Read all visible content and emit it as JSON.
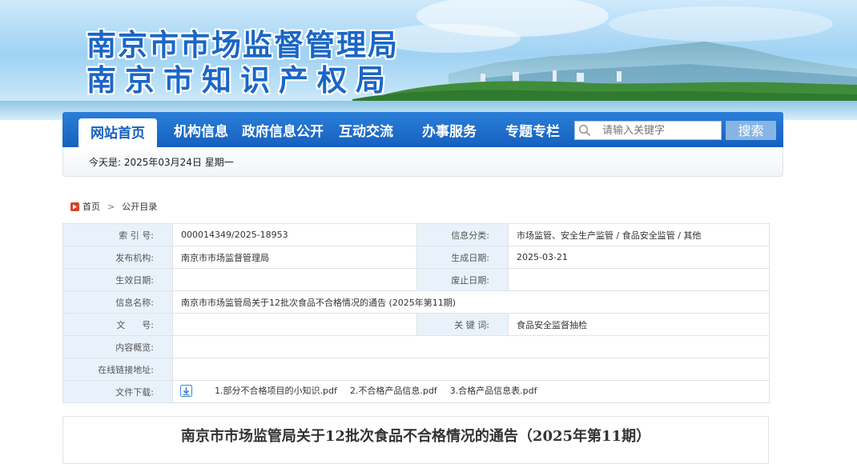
{
  "header": {
    "title_line1": "南京市市场监督管理局",
    "title_line2": "南京市知识产权局"
  },
  "nav": {
    "items": [
      {
        "label": "网站首页",
        "active": true
      },
      {
        "label": "机构信息"
      },
      {
        "label": "政府信息公开"
      },
      {
        "label": "互动交流"
      },
      {
        "label": "办事服务"
      },
      {
        "label": "专题专栏"
      }
    ],
    "search_placeholder": "请输入关键字",
    "search_button": "搜索"
  },
  "datebar": {
    "text": "今天是:  2025年03月24日  星期一"
  },
  "breadcrumb": {
    "home": "首页",
    "current": "公开目录"
  },
  "info": {
    "index_label": "索 引 号:",
    "index_value": "000014349/2025-18953",
    "category_label": "信息分类:",
    "category_value": "市场监管、安全生产监管 / 食品安全监管 / 其他",
    "publisher_label": "发布机构:",
    "publisher_value": "南京市市场监督管理局",
    "created_label": "生成日期:",
    "created_value": "2025-03-21",
    "effective_label": "生效日期:",
    "effective_value": "",
    "abolish_label": "废止日期:",
    "abolish_value": "",
    "name_label": "信息名称:",
    "name_value": "南京市市场监管局关于12批次食品不合格情况的通告 (2025年第11期)",
    "docno_label": "文      号:",
    "docno_value": "",
    "keywords_label": "关 键 词:",
    "keywords_value": "食品安全监督抽检",
    "summary_label": "内容概览:",
    "summary_value": "",
    "link_label": "在线链接地址:",
    "link_value": "",
    "download_label": "文件下载:",
    "files": [
      "1.部分不合格项目的小知识.pdf",
      "2.不合格产品信息.pdf",
      "3.合格产品信息表.pdf"
    ]
  },
  "article": {
    "title": "南京市市场监管局关于12批次食品不合格情况的通告（2025年第11期）"
  }
}
